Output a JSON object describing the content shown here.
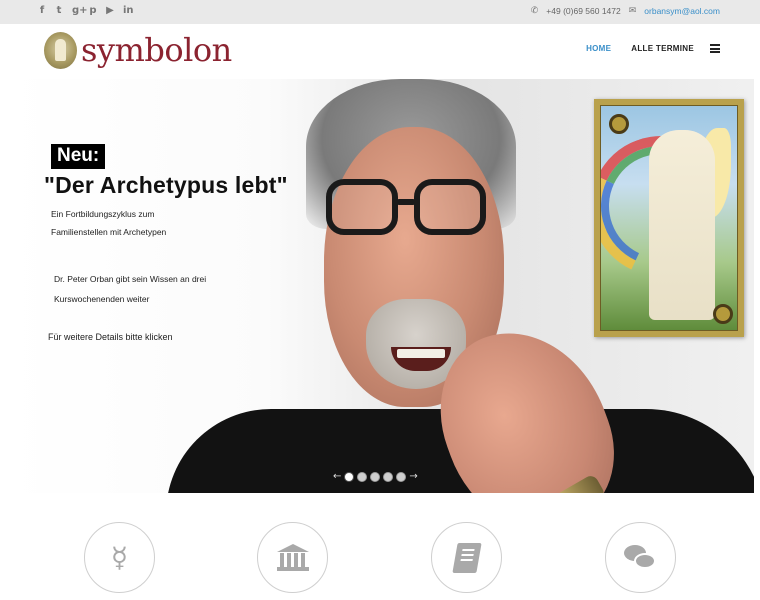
{
  "topbar": {
    "social": [
      {
        "icon": "facebook-icon",
        "glyph": "f"
      },
      {
        "icon": "twitter-icon",
        "glyph": "t"
      },
      {
        "icon": "google-plus-icon",
        "glyph": "g+"
      },
      {
        "icon": "pinterest-icon",
        "glyph": "p"
      },
      {
        "icon": "youtube-icon",
        "glyph": "▶"
      },
      {
        "icon": "linkedin-icon",
        "glyph": "in"
      }
    ],
    "phone": "+49 (0)69 560 1472",
    "email": "orbansym@aol.com"
  },
  "header": {
    "logo_text": "symbolon",
    "nav": {
      "home": "HOME",
      "termine": "ALLE TERMINE"
    }
  },
  "hero": {
    "badge": "Neu:",
    "headline": "\"Der Archetypus lebt\"",
    "line1": "Ein Fortbildungszyklus zum",
    "line2": "Familienstellen mit Archetypen",
    "line3": "Dr. Peter Orban gibt sein Wissen an drei",
    "line4": "Kurswochenenden weiter",
    "details": "Für weitere Details bitte klicken",
    "slider": {
      "prev": "←",
      "next": "→",
      "slides": 5,
      "active": 1
    }
  },
  "features": [
    {
      "icon": "mercury-symbol-icon",
      "glyph": "☿"
    },
    {
      "icon": "institution-icon"
    },
    {
      "icon": "book-icon"
    },
    {
      "icon": "comments-icon"
    }
  ],
  "colors": {
    "accent": "#3a8fc9",
    "logo": "#8b2330",
    "topbar": "#e9e9e9"
  }
}
